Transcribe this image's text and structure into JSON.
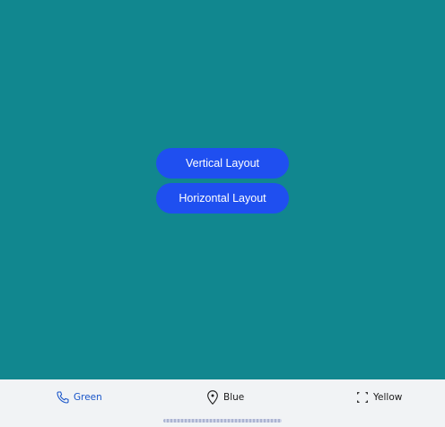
{
  "main": {
    "buttons": {
      "vertical_label": "Vertical Layout",
      "horizontal_label": "Horizontal Layout"
    },
    "background_color": "#11878f",
    "button_color": "#1f4ff0"
  },
  "tabbar": {
    "active_color": "#1a56c9",
    "tabs": [
      {
        "label": "Green",
        "icon": "phone-icon",
        "active": true
      },
      {
        "label": "Blue",
        "icon": "location-pin-icon",
        "active": false
      },
      {
        "label": "Yellow",
        "icon": "scan-frame-icon",
        "active": false
      }
    ]
  }
}
